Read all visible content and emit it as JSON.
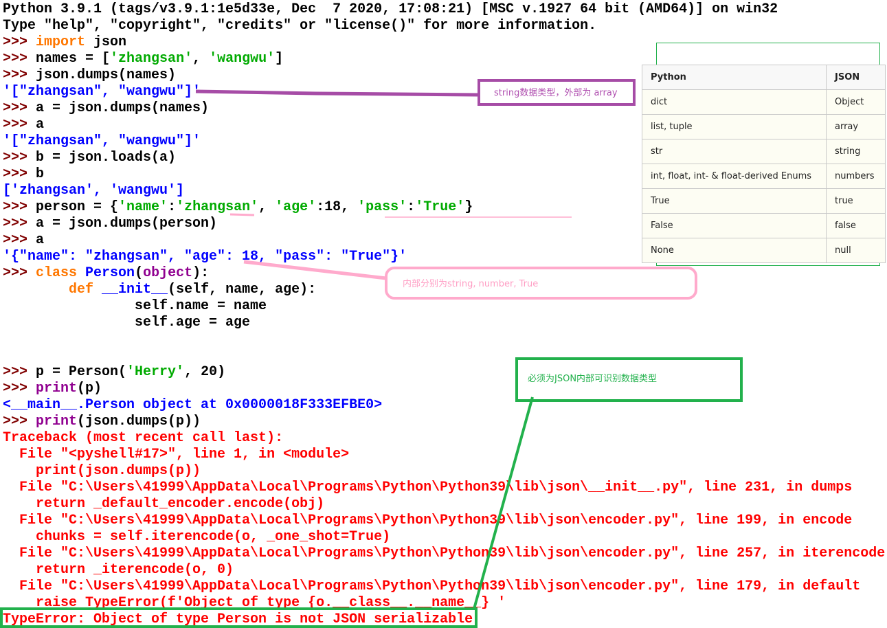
{
  "shell_lines": [
    [
      {
        "t": "Python 3.9.1 (tags/v3.9.1:1e5d33e, Dec  7 2020, 17:08:21) [MSC v.1927 64 bit (AMD64)] on win32",
        "c": "plain"
      }
    ],
    [
      {
        "t": "Type \"help\", \"copyright\", \"credits\" or \"license()\" for more information.",
        "c": "plain"
      }
    ],
    [
      {
        "t": ">>> ",
        "c": "prompt"
      },
      {
        "t": "import",
        "c": "kw"
      },
      {
        "t": " json",
        "c": "plain"
      }
    ],
    [
      {
        "t": ">>> ",
        "c": "prompt"
      },
      {
        "t": "names = [",
        "c": "plain"
      },
      {
        "t": "'zhangsan'",
        "c": "str"
      },
      {
        "t": ", ",
        "c": "plain"
      },
      {
        "t": "'wangwu'",
        "c": "str"
      },
      {
        "t": "]",
        "c": "plain"
      }
    ],
    [
      {
        "t": ">>> ",
        "c": "prompt"
      },
      {
        "t": "json.dumps(names)",
        "c": "plain"
      }
    ],
    [
      {
        "t": "'[\"zhangsan\", \"wangwu\"]'",
        "c": "out"
      }
    ],
    [
      {
        "t": ">>> ",
        "c": "prompt"
      },
      {
        "t": "a = json.dumps(names)",
        "c": "plain"
      }
    ],
    [
      {
        "t": ">>> ",
        "c": "prompt"
      },
      {
        "t": "a",
        "c": "plain"
      }
    ],
    [
      {
        "t": "'[\"zhangsan\", \"wangwu\"]'",
        "c": "out"
      }
    ],
    [
      {
        "t": ">>> ",
        "c": "prompt"
      },
      {
        "t": "b = json.loads(a)",
        "c": "plain"
      }
    ],
    [
      {
        "t": ">>> ",
        "c": "prompt"
      },
      {
        "t": "b",
        "c": "plain"
      }
    ],
    [
      {
        "t": "['zhangsan', 'wangwu']",
        "c": "out"
      }
    ],
    [
      {
        "t": ">>> ",
        "c": "prompt"
      },
      {
        "t": "person = {",
        "c": "plain"
      },
      {
        "t": "'name'",
        "c": "str"
      },
      {
        "t": ":",
        "c": "plain"
      },
      {
        "t": "'zhangsan'",
        "c": "str"
      },
      {
        "t": ", ",
        "c": "plain"
      },
      {
        "t": "'age'",
        "c": "str"
      },
      {
        "t": ":18, ",
        "c": "plain"
      },
      {
        "t": "'pass'",
        "c": "str"
      },
      {
        "t": ":",
        "c": "plain"
      },
      {
        "t": "'True'",
        "c": "str"
      },
      {
        "t": "}",
        "c": "plain"
      }
    ],
    [
      {
        "t": ">>> ",
        "c": "prompt"
      },
      {
        "t": "a = json.dumps(person)",
        "c": "plain"
      }
    ],
    [
      {
        "t": ">>> ",
        "c": "prompt"
      },
      {
        "t": "a",
        "c": "plain"
      }
    ],
    [
      {
        "t": "'{\"name\": \"zhangsan\", \"age\": 18, \"pass\": \"True\"}'",
        "c": "out"
      }
    ],
    [
      {
        "t": ">>> ",
        "c": "prompt"
      },
      {
        "t": "class",
        "c": "kw"
      },
      {
        "t": " ",
        "c": "plain"
      },
      {
        "t": "Person",
        "c": "out"
      },
      {
        "t": "(",
        "c": "plain"
      },
      {
        "t": "object",
        "c": "bi"
      },
      {
        "t": "):",
        "c": "plain"
      }
    ],
    [
      {
        "t": "        ",
        "c": "plain"
      },
      {
        "t": "def",
        "c": "kw"
      },
      {
        "t": " ",
        "c": "plain"
      },
      {
        "t": "__init__",
        "c": "out"
      },
      {
        "t": "(self, name, age):",
        "c": "plain"
      }
    ],
    [
      {
        "t": "                self.name = name",
        "c": "plain"
      }
    ],
    [
      {
        "t": "                self.age = age",
        "c": "plain"
      }
    ],
    [
      {
        "t": "",
        "c": "plain"
      }
    ],
    [
      {
        "t": "",
        "c": "plain"
      }
    ],
    [
      {
        "t": ">>> ",
        "c": "prompt"
      },
      {
        "t": "p = Person(",
        "c": "plain"
      },
      {
        "t": "'Herry'",
        "c": "str"
      },
      {
        "t": ", 20)",
        "c": "plain"
      }
    ],
    [
      {
        "t": ">>> ",
        "c": "prompt"
      },
      {
        "t": "print",
        "c": "bi"
      },
      {
        "t": "(p)",
        "c": "plain"
      }
    ],
    [
      {
        "t": "<__main__.Person object at 0x0000018F333EFBE0>",
        "c": "out"
      }
    ],
    [
      {
        "t": ">>> ",
        "c": "prompt"
      },
      {
        "t": "print",
        "c": "bi"
      },
      {
        "t": "(json.dumps(p))",
        "c": "plain"
      }
    ],
    [
      {
        "t": "Traceback (most recent call last):",
        "c": "err"
      }
    ],
    [
      {
        "t": "  File \"<pyshell#17>\", line 1, in <module>",
        "c": "err"
      }
    ],
    [
      {
        "t": "    print(json.dumps(p))",
        "c": "err"
      }
    ],
    [
      {
        "t": "  File \"C:\\Users\\41999\\AppData\\Local\\Programs\\Python\\Python39\\lib\\json\\__init__.py\", line 231, in dumps",
        "c": "err"
      }
    ],
    [
      {
        "t": "    return _default_encoder.encode(obj)",
        "c": "err"
      }
    ],
    [
      {
        "t": "  File \"C:\\Users\\41999\\AppData\\Local\\Programs\\Python\\Python39\\lib\\json\\encoder.py\", line 199, in encode",
        "c": "err"
      }
    ],
    [
      {
        "t": "    chunks = self.iterencode(o, _one_shot=True)",
        "c": "err"
      }
    ],
    [
      {
        "t": "  File \"C:\\Users\\41999\\AppData\\Local\\Programs\\Python\\Python39\\lib\\json\\encoder.py\", line 257, in iterencode",
        "c": "err"
      }
    ],
    [
      {
        "t": "    return _iterencode(o, 0)",
        "c": "err"
      }
    ],
    [
      {
        "t": "  File \"C:\\Users\\41999\\AppData\\Local\\Programs\\Python\\Python39\\lib\\json\\encoder.py\", line 179, in default",
        "c": "err"
      }
    ],
    [
      {
        "t": "    raise TypeError(f'Object of type {o.__class__.__name__} '",
        "c": "err"
      }
    ],
    [
      {
        "t": "TypeError: Object of type Person is not JSON serializable",
        "c": "err"
      }
    ]
  ],
  "annotations": {
    "array_note": "string数据类型，外部为 array",
    "inner_note": "内部分别为string, number, True",
    "json_note": "必须为JSON内部可识别数据类型"
  },
  "table": {
    "headers": [
      "Python",
      "JSON"
    ],
    "rows": [
      [
        "dict",
        "Object"
      ],
      [
        "list, tuple",
        "array"
      ],
      [
        "str",
        "string"
      ],
      [
        "int, float, int- & float-derived Enums",
        "numbers"
      ],
      [
        "True",
        "true"
      ],
      [
        "False",
        "false"
      ],
      [
        "None",
        "null"
      ]
    ]
  },
  "colors": {
    "prompt": "#800000",
    "keyword": "#ff7700",
    "string": "#00aa00",
    "output": "#0000ff",
    "builtin": "#900090",
    "error": "#ff0000",
    "purple_annotation": "#a64ca6",
    "pink_annotation": "#ffaacc",
    "green_annotation": "#22b14c"
  }
}
